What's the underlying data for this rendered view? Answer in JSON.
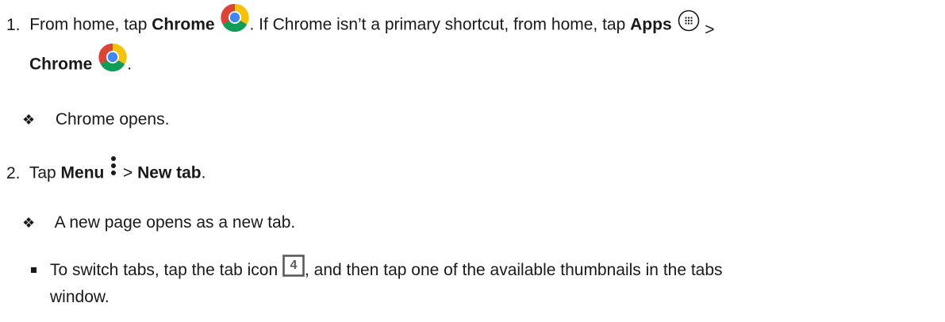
{
  "steps": [
    {
      "number": "1.",
      "line1": {
        "t1": "From home, tap ",
        "b1": "Chrome",
        "t2": ". If Chrome isn’t a primary shortcut, from home, tap ",
        "b2": "Apps",
        "t3": " >"
      },
      "line2": {
        "b1": "Chrome",
        "t1": "."
      },
      "result": "Chrome opens."
    },
    {
      "number": "2.",
      "line1": {
        "t1": "Tap ",
        "b1": "Menu",
        "t2": " > ",
        "b2": "New tab",
        "t3": "."
      },
      "result": "A new page opens as a new tab.",
      "subbullet": {
        "t1": "To switch tabs, tap the tab icon ",
        "tab_count": "4",
        "t2": ", and then tap one of the available thumbnails in the tabs",
        "t3": "window."
      }
    }
  ],
  "result_bullet_glyph": "❖",
  "icons": {
    "chrome": "chrome-icon",
    "apps": "apps-grid-icon",
    "menu": "more-vert-icon",
    "tabs": "tab-switcher-icon"
  },
  "colors": {
    "text": "#1a1a1a",
    "chrome_red": "#db4437",
    "chrome_yellow": "#f4c20d",
    "chrome_green": "#0f9d58",
    "chrome_blue": "#4285f4"
  }
}
